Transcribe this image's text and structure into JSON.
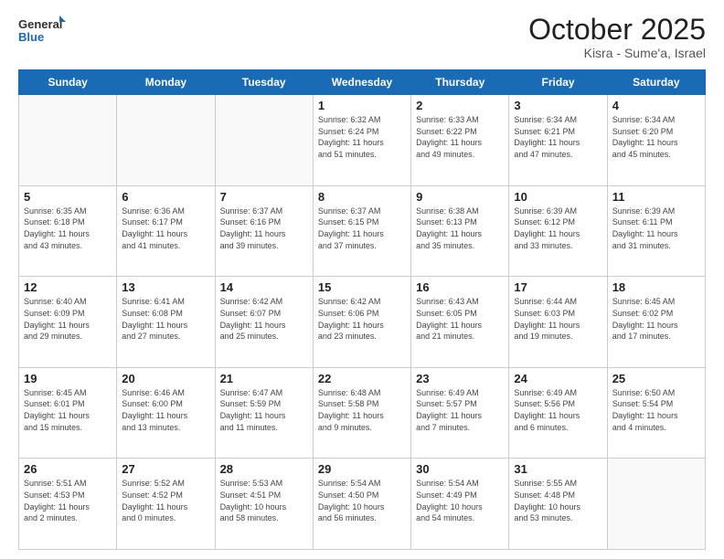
{
  "header": {
    "logo_line1": "General",
    "logo_line2": "Blue",
    "month_title": "October 2025",
    "subtitle": "Kisra - Sume'a, Israel"
  },
  "days_of_week": [
    "Sunday",
    "Monday",
    "Tuesday",
    "Wednesday",
    "Thursday",
    "Friday",
    "Saturday"
  ],
  "weeks": [
    [
      {
        "num": "",
        "info": ""
      },
      {
        "num": "",
        "info": ""
      },
      {
        "num": "",
        "info": ""
      },
      {
        "num": "1",
        "info": "Sunrise: 6:32 AM\nSunset: 6:24 PM\nDaylight: 11 hours\nand 51 minutes."
      },
      {
        "num": "2",
        "info": "Sunrise: 6:33 AM\nSunset: 6:22 PM\nDaylight: 11 hours\nand 49 minutes."
      },
      {
        "num": "3",
        "info": "Sunrise: 6:34 AM\nSunset: 6:21 PM\nDaylight: 11 hours\nand 47 minutes."
      },
      {
        "num": "4",
        "info": "Sunrise: 6:34 AM\nSunset: 6:20 PM\nDaylight: 11 hours\nand 45 minutes."
      }
    ],
    [
      {
        "num": "5",
        "info": "Sunrise: 6:35 AM\nSunset: 6:18 PM\nDaylight: 11 hours\nand 43 minutes."
      },
      {
        "num": "6",
        "info": "Sunrise: 6:36 AM\nSunset: 6:17 PM\nDaylight: 11 hours\nand 41 minutes."
      },
      {
        "num": "7",
        "info": "Sunrise: 6:37 AM\nSunset: 6:16 PM\nDaylight: 11 hours\nand 39 minutes."
      },
      {
        "num": "8",
        "info": "Sunrise: 6:37 AM\nSunset: 6:15 PM\nDaylight: 11 hours\nand 37 minutes."
      },
      {
        "num": "9",
        "info": "Sunrise: 6:38 AM\nSunset: 6:13 PM\nDaylight: 11 hours\nand 35 minutes."
      },
      {
        "num": "10",
        "info": "Sunrise: 6:39 AM\nSunset: 6:12 PM\nDaylight: 11 hours\nand 33 minutes."
      },
      {
        "num": "11",
        "info": "Sunrise: 6:39 AM\nSunset: 6:11 PM\nDaylight: 11 hours\nand 31 minutes."
      }
    ],
    [
      {
        "num": "12",
        "info": "Sunrise: 6:40 AM\nSunset: 6:09 PM\nDaylight: 11 hours\nand 29 minutes."
      },
      {
        "num": "13",
        "info": "Sunrise: 6:41 AM\nSunset: 6:08 PM\nDaylight: 11 hours\nand 27 minutes."
      },
      {
        "num": "14",
        "info": "Sunrise: 6:42 AM\nSunset: 6:07 PM\nDaylight: 11 hours\nand 25 minutes."
      },
      {
        "num": "15",
        "info": "Sunrise: 6:42 AM\nSunset: 6:06 PM\nDaylight: 11 hours\nand 23 minutes."
      },
      {
        "num": "16",
        "info": "Sunrise: 6:43 AM\nSunset: 6:05 PM\nDaylight: 11 hours\nand 21 minutes."
      },
      {
        "num": "17",
        "info": "Sunrise: 6:44 AM\nSunset: 6:03 PM\nDaylight: 11 hours\nand 19 minutes."
      },
      {
        "num": "18",
        "info": "Sunrise: 6:45 AM\nSunset: 6:02 PM\nDaylight: 11 hours\nand 17 minutes."
      }
    ],
    [
      {
        "num": "19",
        "info": "Sunrise: 6:45 AM\nSunset: 6:01 PM\nDaylight: 11 hours\nand 15 minutes."
      },
      {
        "num": "20",
        "info": "Sunrise: 6:46 AM\nSunset: 6:00 PM\nDaylight: 11 hours\nand 13 minutes."
      },
      {
        "num": "21",
        "info": "Sunrise: 6:47 AM\nSunset: 5:59 PM\nDaylight: 11 hours\nand 11 minutes."
      },
      {
        "num": "22",
        "info": "Sunrise: 6:48 AM\nSunset: 5:58 PM\nDaylight: 11 hours\nand 9 minutes."
      },
      {
        "num": "23",
        "info": "Sunrise: 6:49 AM\nSunset: 5:57 PM\nDaylight: 11 hours\nand 7 minutes."
      },
      {
        "num": "24",
        "info": "Sunrise: 6:49 AM\nSunset: 5:56 PM\nDaylight: 11 hours\nand 6 minutes."
      },
      {
        "num": "25",
        "info": "Sunrise: 6:50 AM\nSunset: 5:54 PM\nDaylight: 11 hours\nand 4 minutes."
      }
    ],
    [
      {
        "num": "26",
        "info": "Sunrise: 5:51 AM\nSunset: 4:53 PM\nDaylight: 11 hours\nand 2 minutes."
      },
      {
        "num": "27",
        "info": "Sunrise: 5:52 AM\nSunset: 4:52 PM\nDaylight: 11 hours\nand 0 minutes."
      },
      {
        "num": "28",
        "info": "Sunrise: 5:53 AM\nSunset: 4:51 PM\nDaylight: 10 hours\nand 58 minutes."
      },
      {
        "num": "29",
        "info": "Sunrise: 5:54 AM\nSunset: 4:50 PM\nDaylight: 10 hours\nand 56 minutes."
      },
      {
        "num": "30",
        "info": "Sunrise: 5:54 AM\nSunset: 4:49 PM\nDaylight: 10 hours\nand 54 minutes."
      },
      {
        "num": "31",
        "info": "Sunrise: 5:55 AM\nSunset: 4:48 PM\nDaylight: 10 hours\nand 53 minutes."
      },
      {
        "num": "",
        "info": ""
      }
    ]
  ]
}
